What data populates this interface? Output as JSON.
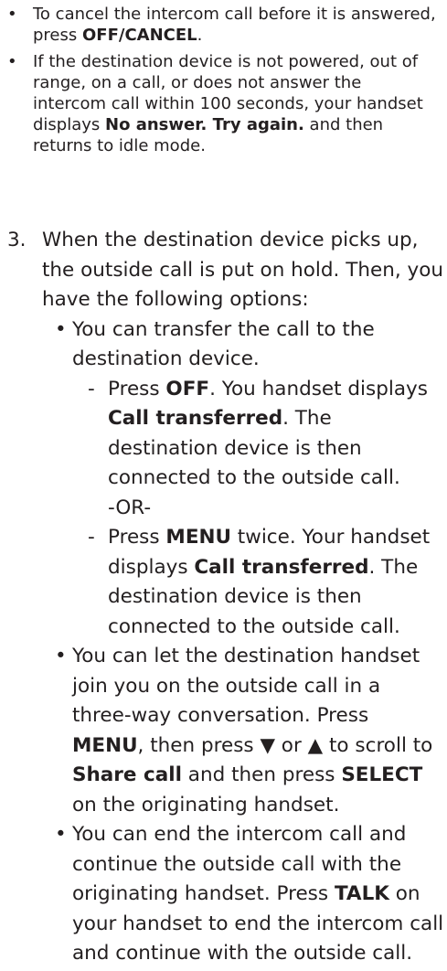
{
  "top_bullets": [
    {
      "parts": [
        {
          "t": "To cancel the intercom call before it is answered, press "
        },
        {
          "b": "OFF/CANCEL"
        },
        {
          "t": "."
        }
      ]
    },
    {
      "parts": [
        {
          "t": "If the destination device is not powered, out of range, on a call, or does not answer the intercom call within 100 seconds, your handset displays "
        },
        {
          "b": "No answer. Try again."
        },
        {
          "t": " and then returns to idle mode."
        }
      ]
    }
  ],
  "step": {
    "number": "3.",
    "intro": "When the destination device picks up, the outside call is put on hold. Then, you have the following options:",
    "options": [
      {
        "text": "You can transfer the call to the destination device.",
        "sub": [
          {
            "parts": [
              {
                "t": "Press "
              },
              {
                "b": "OFF"
              },
              {
                "t": ". You handset displays "
              },
              {
                "b": "Call transferred"
              },
              {
                "t": ". The destination device is then connected to the outside call."
              }
            ]
          },
          {
            "parts": [
              {
                "t": "Press "
              },
              {
                "b": "MENU"
              },
              {
                "t": " twice. Your handset displays "
              },
              {
                "b": "Call transferred"
              },
              {
                "t": ". The destination device is then connected to the outside call."
              }
            ]
          }
        ],
        "or_label": "-OR-"
      },
      {
        "parts": [
          {
            "t": "You can let the destination handset join you on the outside call in a three-way conversation. Press "
          },
          {
            "b": "MENU"
          },
          {
            "t": ", then press ▼ or ▲ to scroll to "
          },
          {
            "b": "Share call"
          },
          {
            "t": " and then press "
          },
          {
            "b": "SELECT"
          },
          {
            "t": " on the originating handset."
          }
        ]
      },
      {
        "parts": [
          {
            "t": "You can end the intercom call and continue the outside call with the originating handset. Press "
          },
          {
            "b": "TALK"
          },
          {
            "t": " on your handset to end the intercom call and continue with the outside call."
          }
        ]
      }
    ]
  },
  "bullet_char": "•",
  "dash_char": "-"
}
